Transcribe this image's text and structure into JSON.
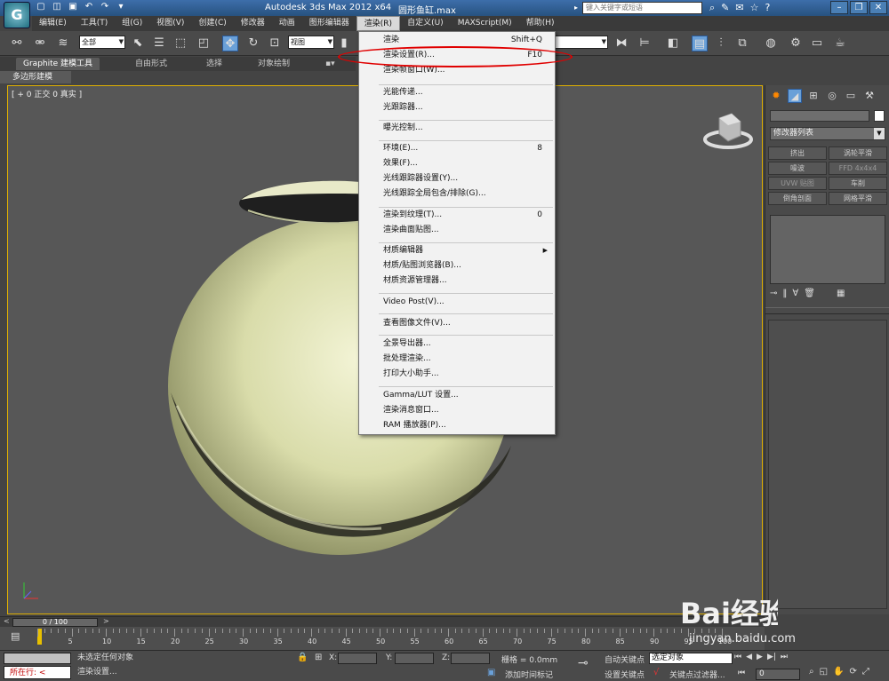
{
  "title_bar": {
    "app_title": "Autodesk 3ds Max  2012 x64",
    "file_name": "圆形鱼缸.max",
    "search_placeholder": "键入关键字或短语",
    "help_icon": "?"
  },
  "menu_bar": {
    "items": [
      {
        "label": "编辑(E)"
      },
      {
        "label": "工具(T)"
      },
      {
        "label": "组(G)"
      },
      {
        "label": "视图(V)"
      },
      {
        "label": "创建(C)"
      },
      {
        "label": "修改器"
      },
      {
        "label": "动画"
      },
      {
        "label": "图形编辑器"
      },
      {
        "label": "渲染(R)",
        "active": true
      },
      {
        "label": "自定义(U)"
      },
      {
        "label": "MAXScript(M)"
      },
      {
        "label": "帮助(H)"
      }
    ]
  },
  "toolbar": {
    "selection_filter": "全部",
    "reference_coord": "视图"
  },
  "ribbon": {
    "tabs": [
      "Graphite 建模工具",
      "自由形式",
      "选择",
      "对象绘制"
    ],
    "sub_panel": "多边形建模"
  },
  "viewport": {
    "label": "[ + 0 正交 0 真实 ]"
  },
  "render_menu": {
    "groups": [
      [
        {
          "label": "渲染",
          "shortcut": "Shift+Q"
        },
        {
          "label": "渲染设置(R)...",
          "shortcut": "F10",
          "highlighted": true
        },
        {
          "label": "渲染帧窗口(W)..."
        }
      ],
      [
        {
          "label": "光能传递..."
        },
        {
          "label": "光跟踪器..."
        }
      ],
      [
        {
          "label": "曝光控制..."
        }
      ],
      [
        {
          "label": "环境(E)...",
          "shortcut": "8"
        },
        {
          "label": "效果(F)..."
        },
        {
          "label": "光线跟踪器设置(Y)..."
        },
        {
          "label": "光线跟踪全局包含/排除(G)..."
        }
      ],
      [
        {
          "label": "渲染到纹理(T)...",
          "shortcut": "0"
        },
        {
          "label": "渲染曲面贴图..."
        }
      ],
      [
        {
          "label": "材质编辑器",
          "submenu": true
        },
        {
          "label": "材质/贴图浏览器(B)..."
        },
        {
          "label": "材质资源管理器..."
        }
      ],
      [
        {
          "label": "Video Post(V)..."
        }
      ],
      [
        {
          "label": "查看图像文件(V)..."
        }
      ],
      [
        {
          "label": "全景导出器..."
        },
        {
          "label": "批处理渲染..."
        },
        {
          "label": "打印大小助手..."
        }
      ],
      [
        {
          "label": "Gamma/LUT 设置..."
        },
        {
          "label": "渲染消息窗口..."
        },
        {
          "label": "RAM 播放器(P)..."
        }
      ]
    ]
  },
  "command_panel": {
    "modifier_list": "修改器列表",
    "buttons": [
      {
        "label": "挤出",
        "enabled": true
      },
      {
        "label": "涡轮平滑",
        "enabled": true
      },
      {
        "label": "噪波",
        "enabled": true
      },
      {
        "label": "FFD 4x4x4",
        "enabled": false
      },
      {
        "label": "UVW 贴图",
        "enabled": false
      },
      {
        "label": "车削",
        "enabled": true
      },
      {
        "label": "倒角剖面",
        "enabled": true
      },
      {
        "label": "网格平滑",
        "enabled": true
      }
    ]
  },
  "timeline": {
    "frame_display": "0 / 100",
    "ticks": [
      5,
      10,
      15,
      20,
      25,
      30,
      35,
      40,
      45,
      50,
      55,
      60,
      65,
      70,
      75,
      80,
      85,
      90,
      95,
      100
    ]
  },
  "status_bar": {
    "line_prompt": "所在行:",
    "status_text": "未选定任何对象",
    "prompt_text": "渲染设置...",
    "x_label": "X:",
    "y_label": "Y:",
    "z_label": "Z:",
    "grid_text": "栅格 = 0.0mm",
    "add_time_tag": "添加时间标记",
    "auto_key": "自动关键点",
    "set_key": "设置关键点",
    "selected_set": "选定对象",
    "key_filters": "关键点过滤器...",
    "frame_value": "0"
  },
  "watermark": {
    "brand": "Bai经验",
    "url": "jingyan.baidu.com"
  },
  "colors": {
    "title_bar": "#2f5f93",
    "viewport_bg": "#575757",
    "viewport_border": "#e0b000",
    "highlight_ring": "#e00000",
    "sphere": "#dfe2b2"
  }
}
